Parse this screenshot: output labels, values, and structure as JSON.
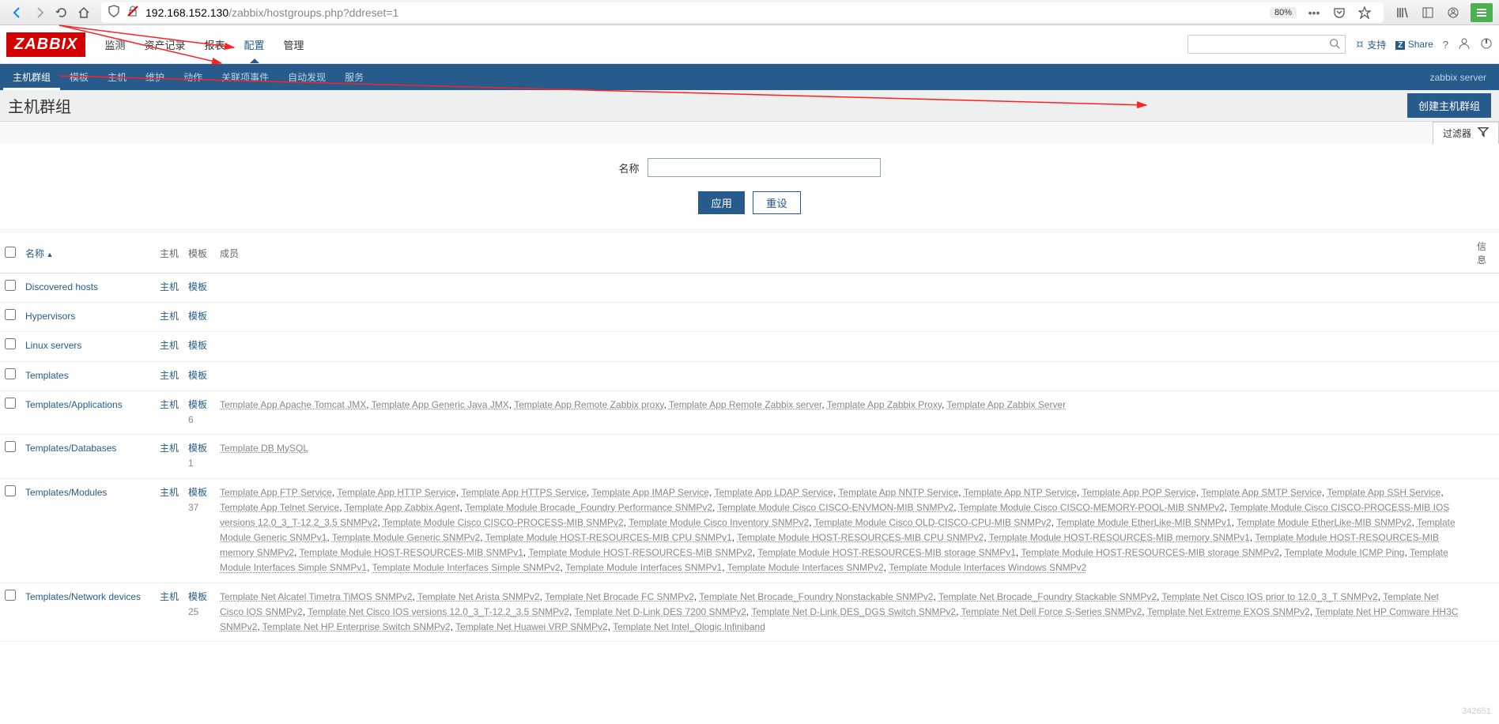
{
  "browser": {
    "url_host": "192.168.152.130",
    "url_path": "/zabbix/hostgroups.php?ddreset=1",
    "zoom": "80%"
  },
  "app": {
    "logo": "ZABBIX",
    "top_menu": [
      "监测",
      "资产记录",
      "报表",
      "配置",
      "管理"
    ],
    "top_menu_active": 3,
    "support": "支持",
    "share": "Share",
    "sub_nav": [
      "主机群组",
      "模板",
      "主机",
      "维护",
      "动作",
      "关联项事件",
      "自动发现",
      "服务"
    ],
    "sub_nav_active": 0,
    "sub_nav_right": "zabbix server"
  },
  "page": {
    "title": "主机群组",
    "create_btn": "创建主机群组"
  },
  "filter": {
    "tab_label": "过滤器",
    "name_label": "名称",
    "name_value": "",
    "apply": "应用",
    "reset": "重设"
  },
  "table": {
    "headers": {
      "name": "名称",
      "hosts": "主机",
      "templates": "模板",
      "members": "成员",
      "info": "信息"
    },
    "rows": [
      {
        "name": "Discovered hosts",
        "hosts": "主机",
        "templates": "模板",
        "tcount": "",
        "members": []
      },
      {
        "name": "Hypervisors",
        "hosts": "主机",
        "templates": "模板",
        "tcount": "",
        "members": []
      },
      {
        "name": "Linux servers",
        "hosts": "主机",
        "templates": "模板",
        "tcount": "",
        "members": []
      },
      {
        "name": "Templates",
        "hosts": "主机",
        "templates": "模板",
        "tcount": "",
        "members": []
      },
      {
        "name": "Templates/Applications",
        "hosts": "主机",
        "templates": "模板",
        "tcount": "6",
        "members": [
          "Template App Apache Tomcat JMX",
          "Template App Generic Java JMX",
          "Template App Remote Zabbix proxy",
          "Template App Remote Zabbix server",
          "Template App Zabbix Proxy",
          "Template App Zabbix Server"
        ]
      },
      {
        "name": "Templates/Databases",
        "hosts": "主机",
        "templates": "模板",
        "tcount": "1",
        "members": [
          "Template DB MySQL"
        ]
      },
      {
        "name": "Templates/Modules",
        "hosts": "主机",
        "templates": "模板",
        "tcount": "37",
        "members": [
          "Template App FTP Service",
          "Template App HTTP Service",
          "Template App HTTPS Service",
          "Template App IMAP Service",
          "Template App LDAP Service",
          "Template App NNTP Service",
          "Template App NTP Service",
          "Template App POP Service",
          "Template App SMTP Service",
          "Template App SSH Service",
          "Template App Telnet Service",
          "Template App Zabbix Agent",
          "Template Module Brocade_Foundry Performance SNMPv2",
          "Template Module Cisco CISCO-ENVMON-MIB SNMPv2",
          "Template Module Cisco CISCO-MEMORY-POOL-MIB SNMPv2",
          "Template Module Cisco CISCO-PROCESS-MIB IOS versions 12.0_3_T-12.2_3.5 SNMPv2",
          "Template Module Cisco CISCO-PROCESS-MIB SNMPv2",
          "Template Module Cisco Inventory SNMPv2",
          "Template Module Cisco OLD-CISCO-CPU-MIB SNMPv2",
          "Template Module EtherLike-MIB SNMPv1",
          "Template Module EtherLike-MIB SNMPv2",
          "Template Module Generic SNMPv1",
          "Template Module Generic SNMPv2",
          "Template Module HOST-RESOURCES-MIB CPU SNMPv1",
          "Template Module HOST-RESOURCES-MIB CPU SNMPv2",
          "Template Module HOST-RESOURCES-MIB memory SNMPv1",
          "Template Module HOST-RESOURCES-MIB memory SNMPv2",
          "Template Module HOST-RESOURCES-MIB SNMPv1",
          "Template Module HOST-RESOURCES-MIB SNMPv2",
          "Template Module HOST-RESOURCES-MIB storage SNMPv1",
          "Template Module HOST-RESOURCES-MIB storage SNMPv2",
          "Template Module ICMP Ping",
          "Template Module Interfaces Simple SNMPv1",
          "Template Module Interfaces Simple SNMPv2",
          "Template Module Interfaces SNMPv1",
          "Template Module Interfaces SNMPv2",
          "Template Module Interfaces Windows SNMPv2"
        ]
      },
      {
        "name": "Templates/Network devices",
        "hosts": "主机",
        "templates": "模板",
        "tcount": "25",
        "members": [
          "Template Net Alcatel Timetra TiMOS SNMPv2",
          "Template Net Arista SNMPv2",
          "Template Net Brocade FC SNMPv2",
          "Template Net Brocade_Foundry Nonstackable SNMPv2",
          "Template Net Brocade_Foundry Stackable SNMPv2",
          "Template Net Cisco IOS prior to 12.0_3_T SNMPv2",
          "Template Net Cisco IOS SNMPv2",
          "Template Net Cisco IOS versions 12.0_3_T-12.2_3.5 SNMPv2",
          "Template Net D-Link DES 7200 SNMPv2",
          "Template Net D-Link DES_DGS Switch SNMPv2",
          "Template Net Dell Force S-Series SNMPv2",
          "Template Net Extreme EXOS SNMPv2",
          "Template Net HP Comware HH3C SNMPv2",
          "Template Net HP Enterprise Switch SNMPv2",
          "Template Net Huawei VRP SNMPv2",
          "Template Net Intel_Qlogic Infiniband"
        ]
      }
    ]
  },
  "watermark": "342651"
}
